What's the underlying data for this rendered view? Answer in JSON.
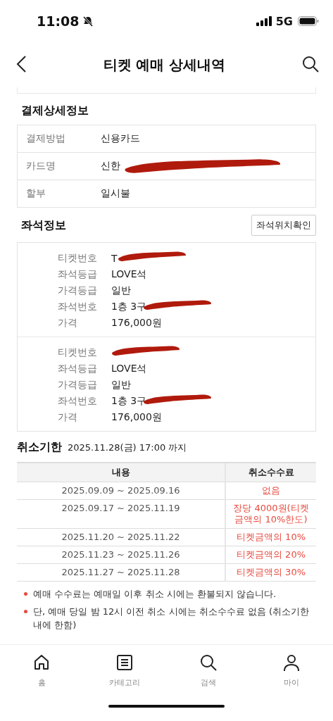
{
  "status_bar": {
    "time": "11:08",
    "network": "5G"
  },
  "header": {
    "title": "티켓 예매 상세내역"
  },
  "payment": {
    "title": "결제상세정보",
    "rows": [
      {
        "label": "결제방법",
        "value": "신용카드",
        "redacted": false
      },
      {
        "label": "카드명",
        "value": "신한",
        "redacted": true
      },
      {
        "label": "할부",
        "value": "일시불",
        "redacted": false
      }
    ]
  },
  "seats": {
    "title": "좌석정보",
    "button": "좌석위치확인",
    "tickets": [
      {
        "rows": [
          {
            "label": "티켓번호",
            "value": "T",
            "redacted": true
          },
          {
            "label": "좌석등급",
            "value": "LOVE석",
            "redacted": false
          },
          {
            "label": "가격등급",
            "value": "일반",
            "redacted": false
          },
          {
            "label": "좌석번호",
            "value": "1층 3구",
            "redacted": true
          },
          {
            "label": "가격",
            "value": "176,000원",
            "redacted": false
          }
        ]
      },
      {
        "rows": [
          {
            "label": "티켓번호",
            "redacted": true
          },
          {
            "label": "좌석등급",
            "value": "LOVE석",
            "redacted": false
          },
          {
            "label": "가격등급",
            "value": "일반",
            "redacted": false
          },
          {
            "label": "좌석번호",
            "value": "1층 3구",
            "redacted": true
          },
          {
            "label": "가격",
            "value": "176,000원",
            "redacted": false
          }
        ]
      }
    ]
  },
  "cancel": {
    "title": "취소기한",
    "deadline": "2025.11.28(금) 17:00 까지",
    "columns": [
      "내용",
      "취소수수료"
    ],
    "rows": [
      {
        "period": "2025.09.09 ~ 2025.09.16",
        "fee": "없음"
      },
      {
        "period": "2025.09.17 ~ 2025.11.19",
        "fee": "장당 4000원(티켓금액의 10%한도)"
      },
      {
        "period": "2025.11.20 ~ 2025.11.22",
        "fee": "티켓금액의 10%"
      },
      {
        "period": "2025.11.23 ~ 2025.11.26",
        "fee": "티켓금액의 20%"
      },
      {
        "period": "2025.11.27 ~ 2025.11.28",
        "fee": "티켓금액의 30%"
      }
    ],
    "notes": [
      "예매 수수료는 예매일 이후 취소 시에는 환불되지 않습니다.",
      "단, 예매 당일 밤 12시 이전 취소 시에는 취소수수료 없음 (취소기한 내에 한함)"
    ]
  },
  "tab_bar": {
    "items": [
      {
        "label": "홈",
        "kind": "home"
      },
      {
        "label": "카테고리",
        "kind": "list"
      },
      {
        "label": "검색",
        "kind": "search"
      },
      {
        "label": "마이",
        "kind": "person"
      }
    ]
  }
}
